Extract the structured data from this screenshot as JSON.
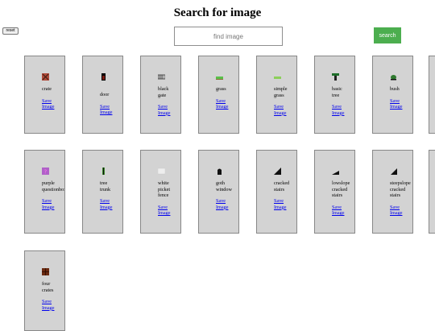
{
  "page_title": "Search for image",
  "reset_label": "reset",
  "search": {
    "placeholder": "find image",
    "button_label": "search"
  },
  "cards": [
    {
      "name": "crate",
      "save_label": "Save\nImage",
      "icon": "crate-icon",
      "color": "#b04a3a"
    },
    {
      "name": "door",
      "save_label": "Save\nImage",
      "icon": "door-icon",
      "color": "#7a1b12"
    },
    {
      "name": "black\ngate",
      "save_label": "Save\nImage",
      "icon": "gate-icon",
      "color": "#333333"
    },
    {
      "name": "grass",
      "save_label": "Save\nImage",
      "icon": "grass-icon",
      "color": "#5ac04a"
    },
    {
      "name": "simple\ngrass",
      "save_label": "Save\nImage",
      "icon": "simple-grass-icon",
      "color": "#8ccf5a"
    },
    {
      "name": "basic\ntree",
      "save_label": "Save\nImage",
      "icon": "tree-icon",
      "color": "#1e6e2a"
    },
    {
      "name": "bush",
      "save_label": "Save\nImage",
      "icon": "bush-icon",
      "color": "#2f7a2f"
    },
    {
      "name": "purple\nquestionbox",
      "save_label": "Save\nImage",
      "icon": "questionbox-icon",
      "color": "#b060c8"
    },
    {
      "name": "tree\ntrunk",
      "save_label": "Save\nImage",
      "icon": "trunk-icon",
      "color": "#3a8a2a"
    },
    {
      "name": "white\npicket\nfence",
      "save_label": "Save\nImage",
      "icon": "fence-icon",
      "color": "#eeeeee"
    },
    {
      "name": "goth\nwindow",
      "save_label": "Save\nImage",
      "icon": "window-icon",
      "color": "#111111"
    },
    {
      "name": "cracked\nstairs",
      "save_label": "Save\nImage",
      "icon": "stairs-icon",
      "color": "#111111"
    },
    {
      "name": "lowslope\ncracked\nstairs",
      "save_label": "Save\nImage",
      "icon": "lowslope-stairs-icon",
      "color": "#111111"
    },
    {
      "name": "steepslope\ncracked\nstairs",
      "save_label": "Save\nImage",
      "icon": "steepslope-stairs-icon",
      "color": "#111111"
    },
    {
      "name": "four\ncrates",
      "save_label": "Save\nImage",
      "icon": "four-crates-icon",
      "color": "#6a2a10"
    }
  ]
}
